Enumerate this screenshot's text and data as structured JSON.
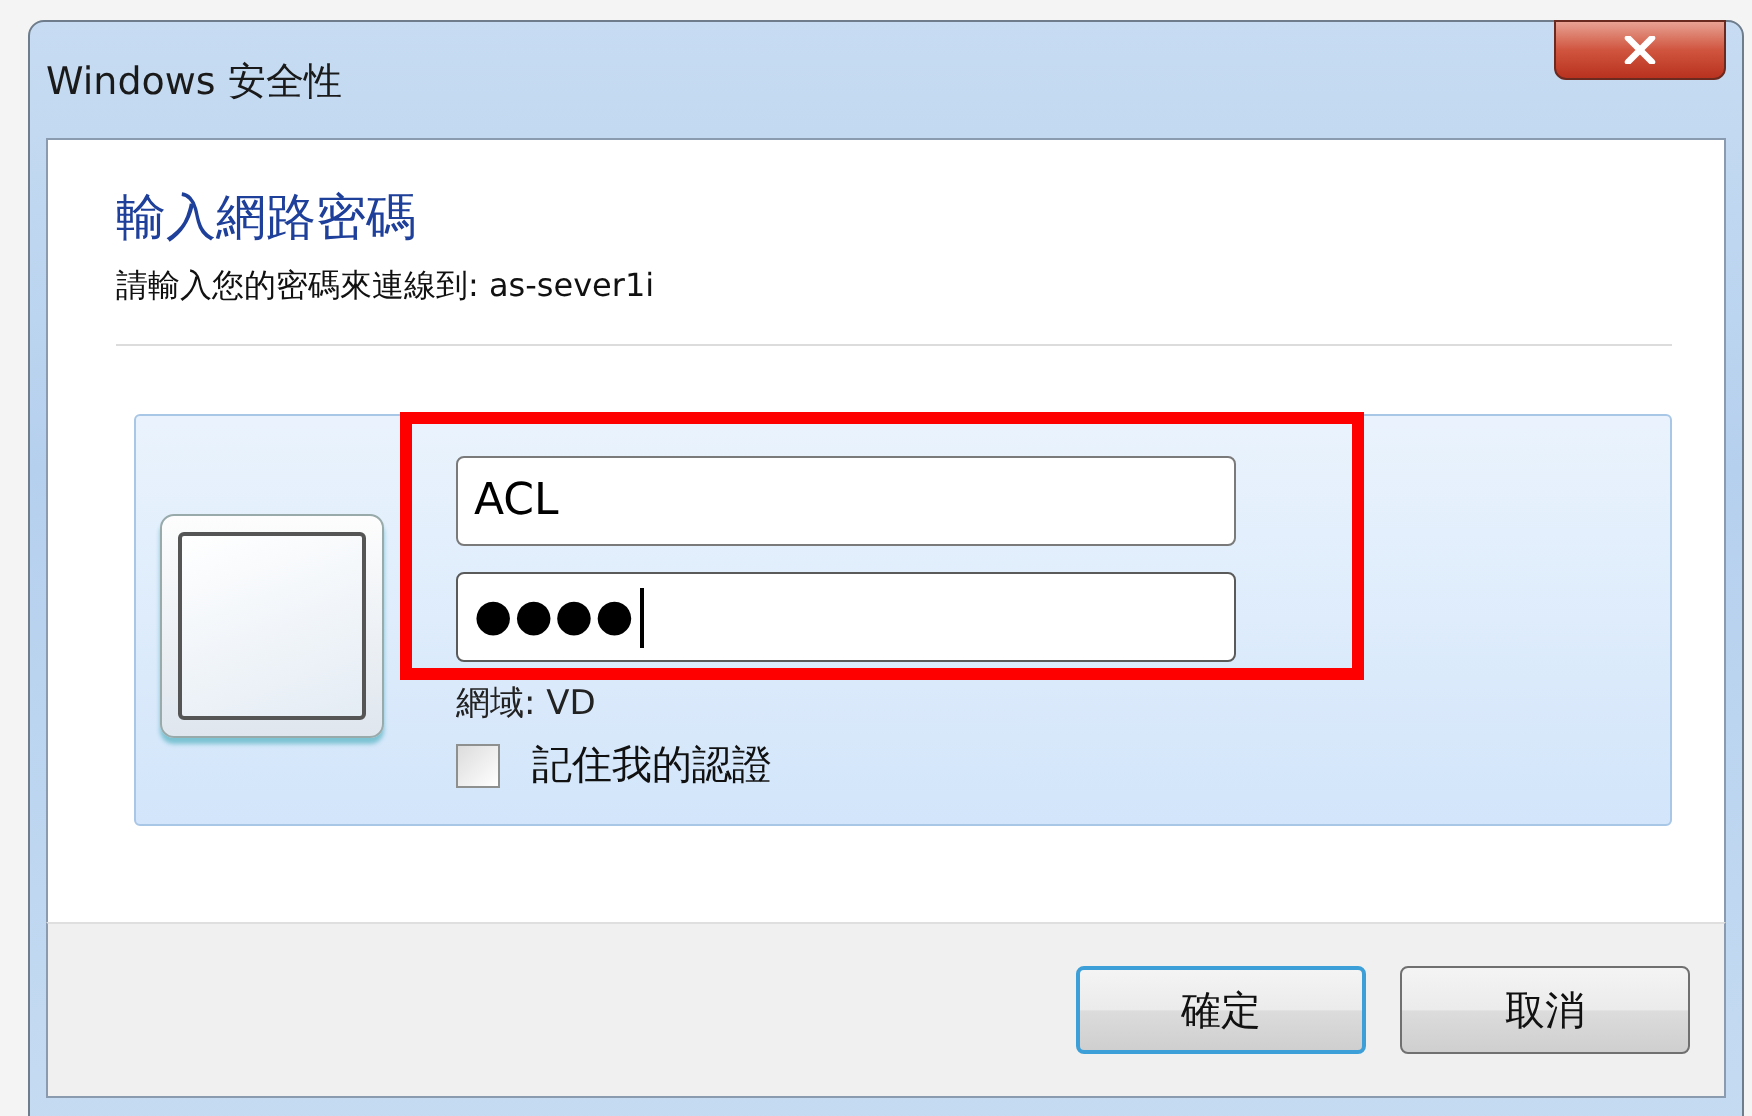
{
  "window": {
    "title": "Windows 安全性"
  },
  "heading": "輸入網路密碼",
  "subtitle": "請輸入您的密碼來連線到: as-sever1i",
  "credentials": {
    "username": "ACL",
    "password": "●●●●",
    "password_focused": true,
    "domain": "網域: VD",
    "remember": {
      "label": "記住我的認證",
      "checked": false
    }
  },
  "annotation": {
    "kind": "highlight"
  },
  "buttons": [
    {
      "label": "確定",
      "default": true
    },
    {
      "label": "取消",
      "default": false
    }
  ]
}
